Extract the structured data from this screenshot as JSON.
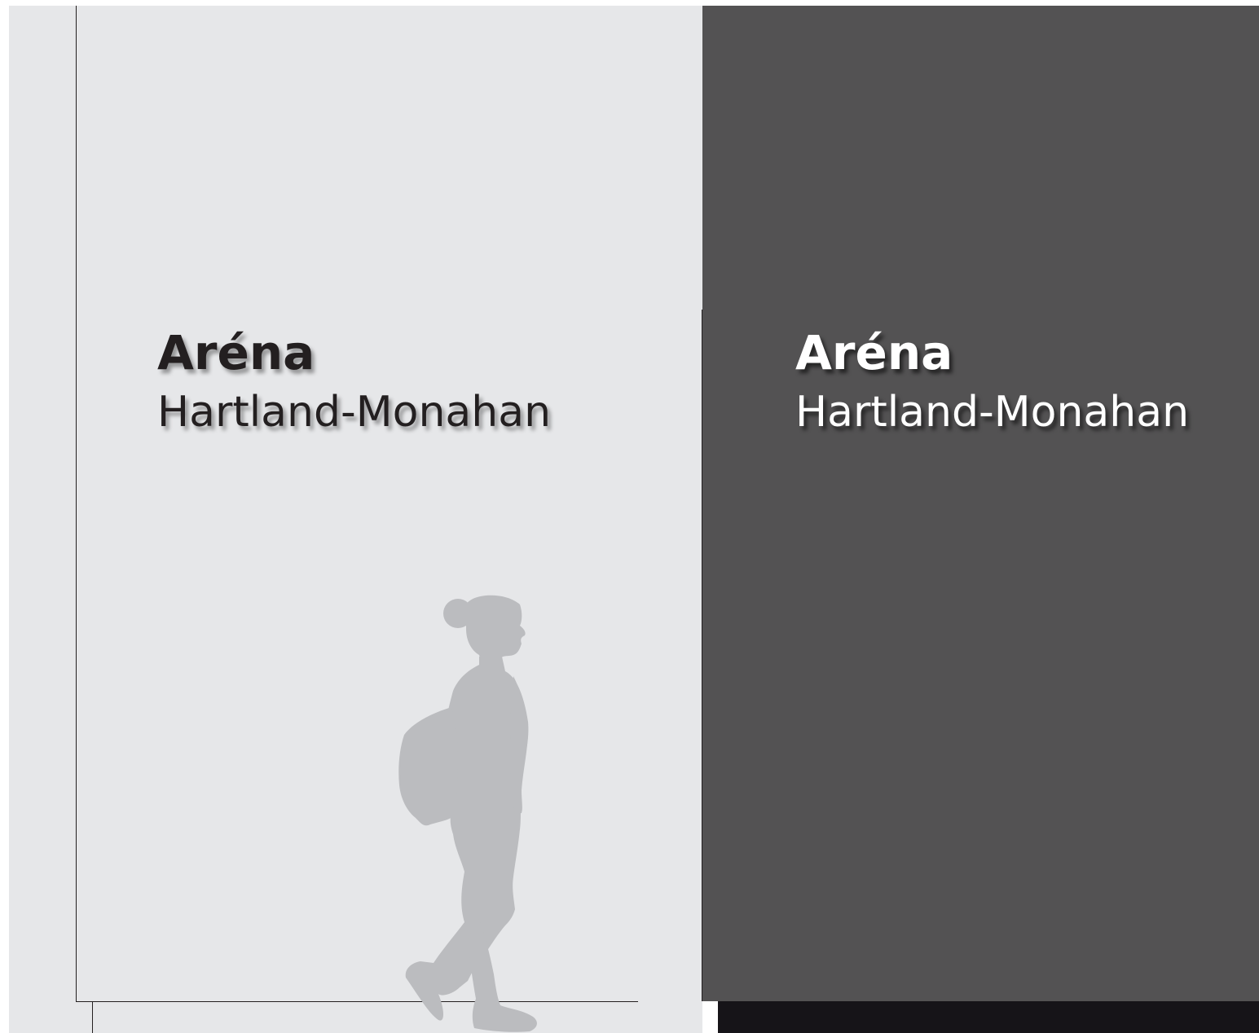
{
  "signs": [
    {
      "title": "Aréna",
      "subtitle": "Hartland-Monahan",
      "variant": "light"
    },
    {
      "title": "Aréna",
      "subtitle": "Hartland-Monahan",
      "variant": "dark"
    }
  ],
  "colors": {
    "light_background": "#e6e7e9",
    "dark_background": "#535253",
    "floor": "#161418",
    "figure": "#bbbcbf",
    "text_dark": "#231f20",
    "text_light": "#ffffff"
  }
}
